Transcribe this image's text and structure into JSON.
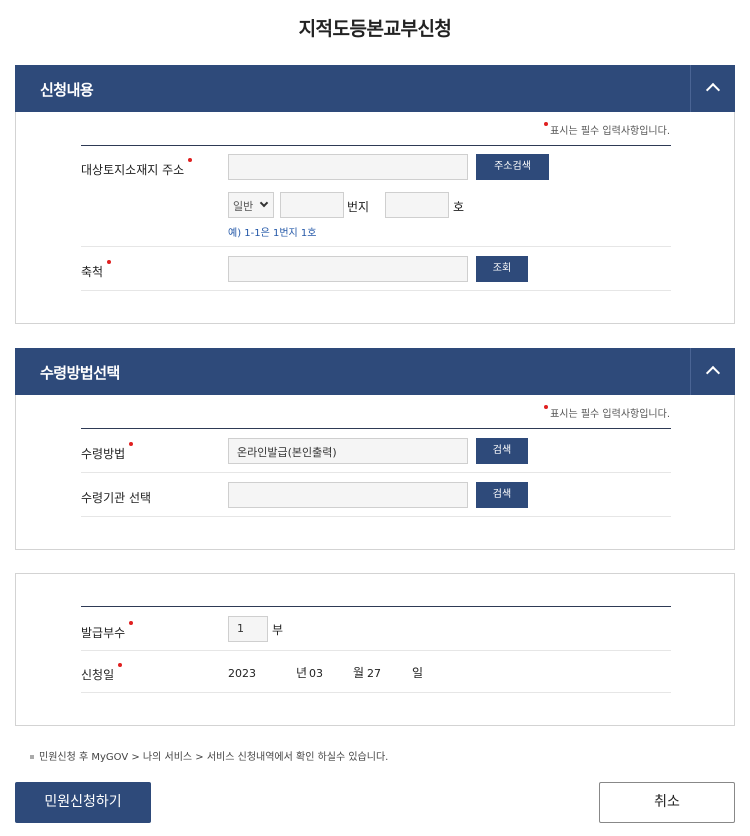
{
  "page": {
    "title": "지적도등본교부신청"
  },
  "common": {
    "required_note": "표시는 필수 입력사항입니다."
  },
  "section1": {
    "title": "신청내용",
    "address_label": "대상토지소재지 주소",
    "address_value": "",
    "address_search_button": "주소검색",
    "land_type_selected": "일반",
    "bun_value": "",
    "bun_unit": "번지",
    "ho_value": "",
    "ho_unit": "호",
    "example_hint": "예) 1-1은 1번지 1호",
    "scale_label": "축척",
    "scale_value": "",
    "scale_button": "조회"
  },
  "section2": {
    "title": "수령방법선택",
    "method_label": "수령방법",
    "method_value": "온라인발급(본인출력)",
    "method_button": "검색",
    "agency_label": "수령기관 선택",
    "agency_value": "",
    "agency_button": "검색"
  },
  "section3": {
    "copies_label": "발급부수",
    "copies_value": "1",
    "copies_unit": "부",
    "date_label": "신청일",
    "year": "2023",
    "year_unit": "년",
    "month": "03",
    "month_unit": "월",
    "day": "27",
    "day_unit": "일"
  },
  "footnote": "민원신청 후 MyGOV > 나의 서비스 > 서비스 신청내역에서 확인 하실수 있습니다.",
  "buttons": {
    "submit": "민원신청하기",
    "cancel": "취소"
  },
  "colors": {
    "accent": "#2e4a7a",
    "required": "#e02020",
    "hint": "#2458a8"
  }
}
